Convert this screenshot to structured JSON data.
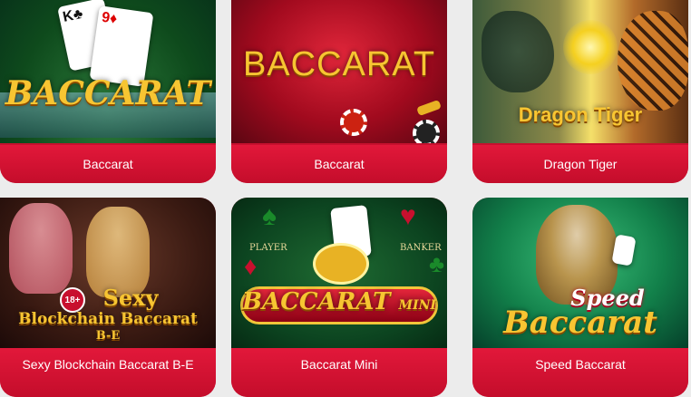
{
  "games": [
    {
      "label": "Baccarat",
      "art_text": "BACCARAT"
    },
    {
      "label": "Baccarat",
      "art_text": "BACCARAT"
    },
    {
      "label": "Dragon Tiger",
      "art_text": "Dragon Tiger"
    },
    {
      "label": "Sexy Blockchain Baccarat B-E",
      "art_text_1": "Sexy",
      "art_text_2": "Blockchain Baccarat",
      "art_text_3": "B-E",
      "badge": "18+"
    },
    {
      "label": "Baccarat Mini",
      "art_text": "BACCARAT",
      "art_small": "MINI",
      "player": "PLAYER",
      "banker": "BANKER"
    },
    {
      "label": "Speed Baccarat",
      "art_text_1": "Speed",
      "art_text_2": "Baccarat"
    }
  ],
  "colors": {
    "label_bg": "#c8102e",
    "page_bg": "#ececec",
    "gold": "#f7c532"
  }
}
